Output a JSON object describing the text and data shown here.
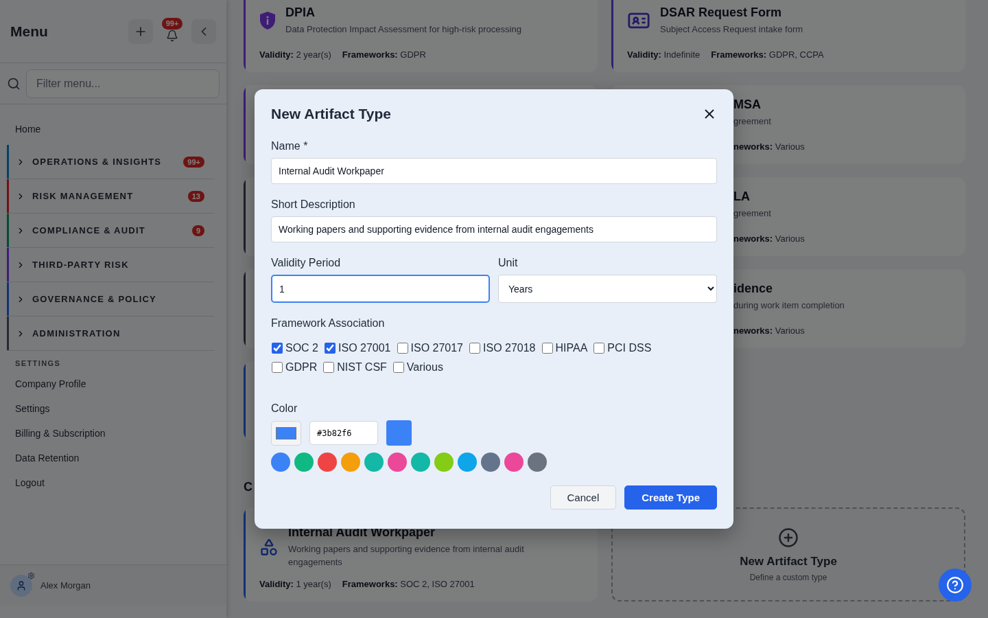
{
  "sidebar": {
    "title": "Menu",
    "notification_badge": "99+",
    "filter": {
      "placeholder": "Filter menu..."
    },
    "home": "Home",
    "groups": [
      {
        "label": "OPERATIONS & INSIGHTS",
        "color": "#014263",
        "badge": "99+",
        "expanded": false
      },
      {
        "label": "RISK MANAGEMENT",
        "color": "#6e1313",
        "badge": "13",
        "expanded": false
      },
      {
        "label": "COMPLIANCE & AUDIT",
        "color": "#034b35",
        "badge": "9",
        "expanded": false
      },
      {
        "label": "THIRD-PARTY RISK",
        "color": "#3e1d77",
        "expanded": false
      },
      {
        "label": "GOVERNANCE & POLICY",
        "color": "#133276",
        "expanded": false
      },
      {
        "label": "ADMINISTRATION",
        "color": "#262b32",
        "expanded": false
      }
    ],
    "settings_heading": "SETTINGS",
    "settings_items": [
      "Company Profile",
      "Settings",
      "Billing & Subscription",
      "Data Retention",
      "Logout"
    ],
    "user": "Alex Morgan"
  },
  "cards": [
    {
      "kind": "full",
      "color": "#3e1d77",
      "title": "DPIA",
      "description": "Data Protection Impact Assessment for high-risk processing",
      "validity": "**Validity:** 2 year(s)",
      "frameworks": "**Frameworks:** GDPR"
    },
    {
      "kind": "full",
      "color": "#282373",
      "title": "DSAR Request Form",
      "description": "Subject Access Request intake form",
      "validity": "**Validity:** Indefinite",
      "frameworks": "**Frameworks:** GDPR, CCPA"
    },
    {
      "kind": "hidden",
      "color": "#3e1d77"
    },
    {
      "kind": "partial",
      "title": "MSA",
      "description": "greement",
      "frameworks": "**neworks:** Various"
    },
    {
      "kind": "hidden",
      "color": "#1c2129"
    },
    {
      "kind": "partial",
      "title": "LA",
      "description": "greement",
      "frameworks": "**neworks:** Various"
    },
    {
      "kind": "hidden",
      "color": "#1c2129"
    },
    {
      "kind": "partial",
      "title": "idence",
      "description": "during work item completion",
      "frameworks": "**neworks:** Various"
    },
    {
      "kind": "hidden",
      "color": "#133276"
    }
  ],
  "section_title": "C",
  "bottom_cards": [
    {
      "kind": "full",
      "color": "#133276",
      "title": "Internal Audit Workpaper",
      "description": "Working papers and supporting evidence from internal audit engagements",
      "validity": "**Validity:** 1 year(s)",
      "frameworks": "**Frameworks:** SOC 2, ISO 27001"
    },
    {
      "kind": "new",
      "title": "New Artifact Type",
      "description": "Define a custom type"
    }
  ],
  "dialog": {
    "title": "New Artifact Type",
    "name": {
      "label": "Name *",
      "value": "Internal Audit Workpaper"
    },
    "description": {
      "label": "Short Description",
      "value": "Working papers and supporting evidence from internal audit engagements"
    },
    "validity": {
      "label": "Validity Period",
      "value": "1"
    },
    "unit": {
      "label": "Unit",
      "value": "Years"
    },
    "frameworks_label": "Framework Association",
    "frameworks": [
      {
        "label": "SOC 2",
        "checked": true
      },
      {
        "label": "ISO 27001",
        "checked": true
      },
      {
        "label": "ISO 27017",
        "checked": false
      },
      {
        "label": "ISO 27018",
        "checked": false
      },
      {
        "label": "HIPAA",
        "checked": false
      },
      {
        "label": "PCI DSS",
        "checked": false
      },
      {
        "label": "GDPR",
        "checked": false
      },
      {
        "label": "NIST CSF",
        "checked": false
      },
      {
        "label": "Various",
        "checked": false
      }
    ],
    "color_label": "Color",
    "color_value": "#3b82f6",
    "palette": [
      {
        "color": "#3b82f6"
      },
      {
        "color": "#10b981"
      },
      {
        "color": "#ef4444"
      },
      {
        "color": "#f59e0b"
      },
      {
        "color": "#14b8a6"
      },
      {
        "color": "#ec4899"
      },
      {
        "color": "#14b8a6"
      },
      {
        "color": "#84cc16"
      },
      {
        "color": "#0ea5e9"
      },
      {
        "color": "#64748b"
      },
      {
        "color": "#ec4899"
      },
      {
        "color": "#6b7280"
      }
    ],
    "buttons": [
      {
        "label": "Cancel",
        "kind": "secondary"
      },
      {
        "label": "Create Type",
        "kind": "primary"
      }
    ]
  }
}
